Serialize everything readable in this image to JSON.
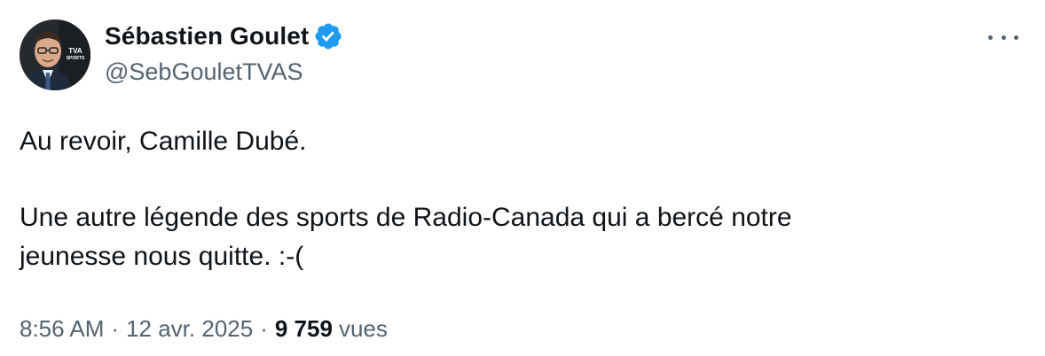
{
  "author": {
    "display_name": "Sébastien Goulet",
    "handle": "@SebGouletTVAS",
    "verified": true,
    "avatar_badge_text": "TVA SPORTS"
  },
  "post": {
    "line1": "Au revoir, Camille Dubé.",
    "line2": "Une autre légende des sports de Radio-Canada qui a bercé notre",
    "line3": "jeunesse nous quitte. :-("
  },
  "meta": {
    "time": "8:56 AM",
    "separator": "·",
    "date": "12 avr. 2025",
    "views_count": "9 759",
    "views_label": "vues"
  },
  "icons": {
    "verified": "verified-badge-icon",
    "more": "more-options-icon"
  },
  "colors": {
    "text_primary": "#0f1419",
    "text_secondary": "#536471",
    "verified_blue": "#1d9bf0",
    "background": "#ffffff"
  }
}
